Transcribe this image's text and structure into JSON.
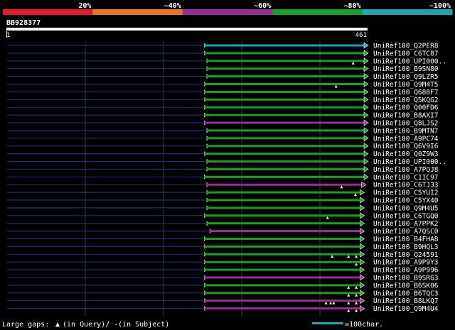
{
  "colors": {
    "background": "#000000",
    "identity_bands": [
      "#e8182a",
      "#e8781e",
      "#9b2d9b",
      "#1aa020",
      "#1aa8b8"
    ],
    "high_identity": "#1aa8b8",
    "green_hit": "#1aa020",
    "purple_hit": "#9b2d9b",
    "query_stub": "#1e2e78",
    "triangle": "#fff8b0",
    "gridline": "#3a3a3a"
  },
  "legend_scale": {
    "labels": [
      "20%",
      "~40%",
      "~60%",
      "~80%",
      "~100%"
    ]
  },
  "query": {
    "id": "BB928377",
    "start_label": "1",
    "end_label": "461",
    "length": 461
  },
  "hits": [
    {
      "name": "UniRef100_Q2PER8",
      "color": "teal",
      "start": 255,
      "end": 461,
      "gaps": []
    },
    {
      "name": "UniRef100_C6TC87",
      "color": "green",
      "start": 255,
      "end": 461,
      "gaps": []
    },
    {
      "name": "UniRef100_UPI000..",
      "color": "green",
      "start": 258,
      "end": 461,
      "gaps": [
        447
      ]
    },
    {
      "name": "UniRef100_B9SN80",
      "color": "green",
      "start": 258,
      "end": 461,
      "gaps": []
    },
    {
      "name": "UniRef100_Q9LZR5",
      "color": "green",
      "start": 258,
      "end": 461,
      "gaps": []
    },
    {
      "name": "UniRef100_Q9M4T5",
      "color": "green",
      "start": 255,
      "end": 461,
      "gaps": [
        425
      ]
    },
    {
      "name": "UniRef100_Q688F7",
      "color": "green",
      "start": 255,
      "end": 461,
      "gaps": []
    },
    {
      "name": "UniRef100_Q5KQG2",
      "color": "green",
      "start": 255,
      "end": 461,
      "gaps": []
    },
    {
      "name": "UniRef100_Q00FD6",
      "color": "green",
      "start": 255,
      "end": 461,
      "gaps": []
    },
    {
      "name": "UniRef100_B8AXI7",
      "color": "green",
      "start": 255,
      "end": 461,
      "gaps": []
    },
    {
      "name": "UniRef100_Q8LJS2",
      "color": "purple",
      "start": 255,
      "end": 461,
      "gaps": []
    },
    {
      "name": "UniRef100_B9MTN7",
      "color": "green",
      "start": 258,
      "end": 461,
      "gaps": []
    },
    {
      "name": "UniRef100_A9PC74",
      "color": "green",
      "start": 258,
      "end": 461,
      "gaps": []
    },
    {
      "name": "UniRef100_Q6V9I6",
      "color": "green",
      "start": 258,
      "end": 461,
      "gaps": []
    },
    {
      "name": "UniRef100_Q0Z9W3",
      "color": "green",
      "start": 255,
      "end": 461,
      "gaps": []
    },
    {
      "name": "UniRef100_UPI000..",
      "color": "green",
      "start": 258,
      "end": 461,
      "gaps": []
    },
    {
      "name": "UniRef100_A7PQJ8",
      "color": "green",
      "start": 258,
      "end": 461,
      "gaps": []
    },
    {
      "name": "UniRef100_C1IC97",
      "color": "green",
      "start": 255,
      "end": 461,
      "gaps": []
    },
    {
      "name": "UniRef100_C6TJ33",
      "color": "purple",
      "start": 258,
      "end": 458,
      "gaps": [
        432
      ]
    },
    {
      "name": "UniRef100_C5YUI2",
      "color": "green",
      "start": 258,
      "end": 456,
      "gaps": [
        450
      ]
    },
    {
      "name": "UniRef100_C5YX40",
      "color": "green",
      "start": 258,
      "end": 456,
      "gaps": []
    },
    {
      "name": "UniRef100_Q9M4U5",
      "color": "green",
      "start": 258,
      "end": 456,
      "gaps": []
    },
    {
      "name": "UniRef100_C6TGQ0",
      "color": "green",
      "start": 255,
      "end": 456,
      "gaps": [
        414
      ]
    },
    {
      "name": "UniRef100_A7PPK2",
      "color": "green",
      "start": 258,
      "end": 456,
      "gaps": []
    },
    {
      "name": "UniRef100_A7QSC0",
      "color": "purple",
      "start": 262,
      "end": 456,
      "gaps": []
    },
    {
      "name": "UniRef100_B4FHA8",
      "color": "green",
      "start": 255,
      "end": 456,
      "gaps": []
    },
    {
      "name": "UniRef100_B9HQL3",
      "color": "green",
      "start": 255,
      "end": 456,
      "gaps": []
    },
    {
      "name": "UniRef100_Q24591",
      "color": "green",
      "start": 255,
      "end": 456,
      "gaps": [
        420,
        441,
        451
      ]
    },
    {
      "name": "UniRef100_A9P9Y3",
      "color": "green",
      "start": 255,
      "end": 456,
      "gaps": [
        451
      ]
    },
    {
      "name": "UniRef100_A9P996",
      "color": "green",
      "start": 255,
      "end": 456,
      "gaps": []
    },
    {
      "name": "UniRef100_B9SRG3",
      "color": "purple",
      "start": 255,
      "end": 456,
      "gaps": []
    },
    {
      "name": "UniRef100_B6SK06",
      "color": "green",
      "start": 255,
      "end": 456,
      "gaps": [
        441,
        451
      ]
    },
    {
      "name": "UniRef100_B6TQC3",
      "color": "green",
      "start": 255,
      "end": 456,
      "gaps": [
        441,
        451
      ]
    },
    {
      "name": "UniRef100_B8LKQ7",
      "color": "purple",
      "start": 255,
      "end": 456,
      "gaps": [
        412,
        418,
        422,
        441,
        451
      ]
    },
    {
      "name": "UniRef100_Q9M4U4",
      "color": "purple",
      "start": 255,
      "end": 456,
      "gaps": [
        441,
        451
      ]
    }
  ],
  "footer": {
    "gaps_label": "Large gaps:",
    "query_gap_symbol": "▲",
    "query_gap_label": "(in Query)/",
    "subject_gap_symbol": "-",
    "subject_gap_label": " (in Subject)",
    "scale_label": "=100char."
  }
}
